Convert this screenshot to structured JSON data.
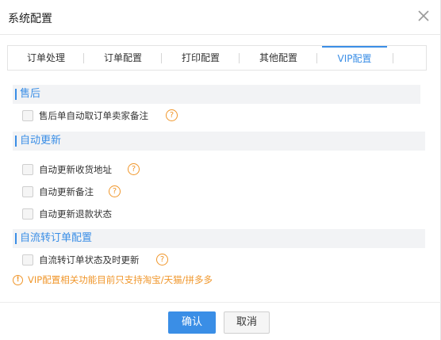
{
  "dialog": {
    "title": "系统配置"
  },
  "tabs": [
    {
      "label": "订单处理"
    },
    {
      "label": "订单配置"
    },
    {
      "label": "打印配置"
    },
    {
      "label": "其他配置"
    },
    {
      "label": "VIP配置",
      "active": true
    }
  ],
  "sections": {
    "after_sale": {
      "title": "售后",
      "options": [
        {
          "label": "售后单自动取订单卖家备注",
          "help": true
        }
      ]
    },
    "auto_update": {
      "title": "自动更新",
      "options": [
        {
          "label": "自动更新收货地址",
          "help": true
        },
        {
          "label": "自动更新备注",
          "help": true
        },
        {
          "label": "自动更新退款状态",
          "help": false
        }
      ]
    },
    "auto_transfer": {
      "title": "自流转订单配置",
      "options": [
        {
          "label": "自流转订单状态及时更新",
          "help": true
        }
      ]
    }
  },
  "notice": {
    "text": "VIP配置相关功能目前只支持淘宝/天猫/拼多多",
    "icon": "warning-icon"
  },
  "footer": {
    "ok_label": "确认",
    "cancel_label": "取消"
  },
  "icons": {
    "help_glyph": "?",
    "warning_glyph": "!"
  },
  "colors": {
    "accent": "#3a8ee6",
    "warning": "#f0962a",
    "section_bg": "#f2f3f5"
  }
}
